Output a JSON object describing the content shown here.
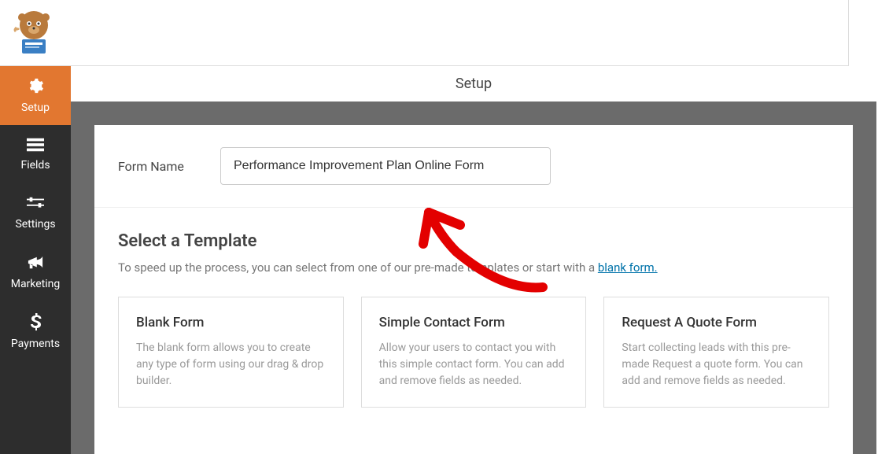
{
  "sidebar": {
    "items": [
      {
        "label": "Setup"
      },
      {
        "label": "Fields"
      },
      {
        "label": "Settings"
      },
      {
        "label": "Marketing"
      },
      {
        "label": "Payments"
      }
    ]
  },
  "header": {
    "title": "Setup"
  },
  "form": {
    "name_label": "Form Name",
    "name_value": "Performance Improvement Plan Online Form"
  },
  "templates": {
    "heading": "Select a Template",
    "subtext_pre": "To speed up the process, you can select from one of our pre-made templates or start with a ",
    "blank_link": "blank form.",
    "cards": [
      {
        "title": "Blank Form",
        "desc": "The blank form allows you to create any type of form using our drag & drop builder."
      },
      {
        "title": "Simple Contact Form",
        "desc": "Allow your users to contact you with this simple contact form. You can add and remove fields as needed."
      },
      {
        "title": "Request A Quote Form",
        "desc": "Start collecting leads with this pre-made Request a quote form. You can add and remove fields as needed."
      }
    ]
  }
}
